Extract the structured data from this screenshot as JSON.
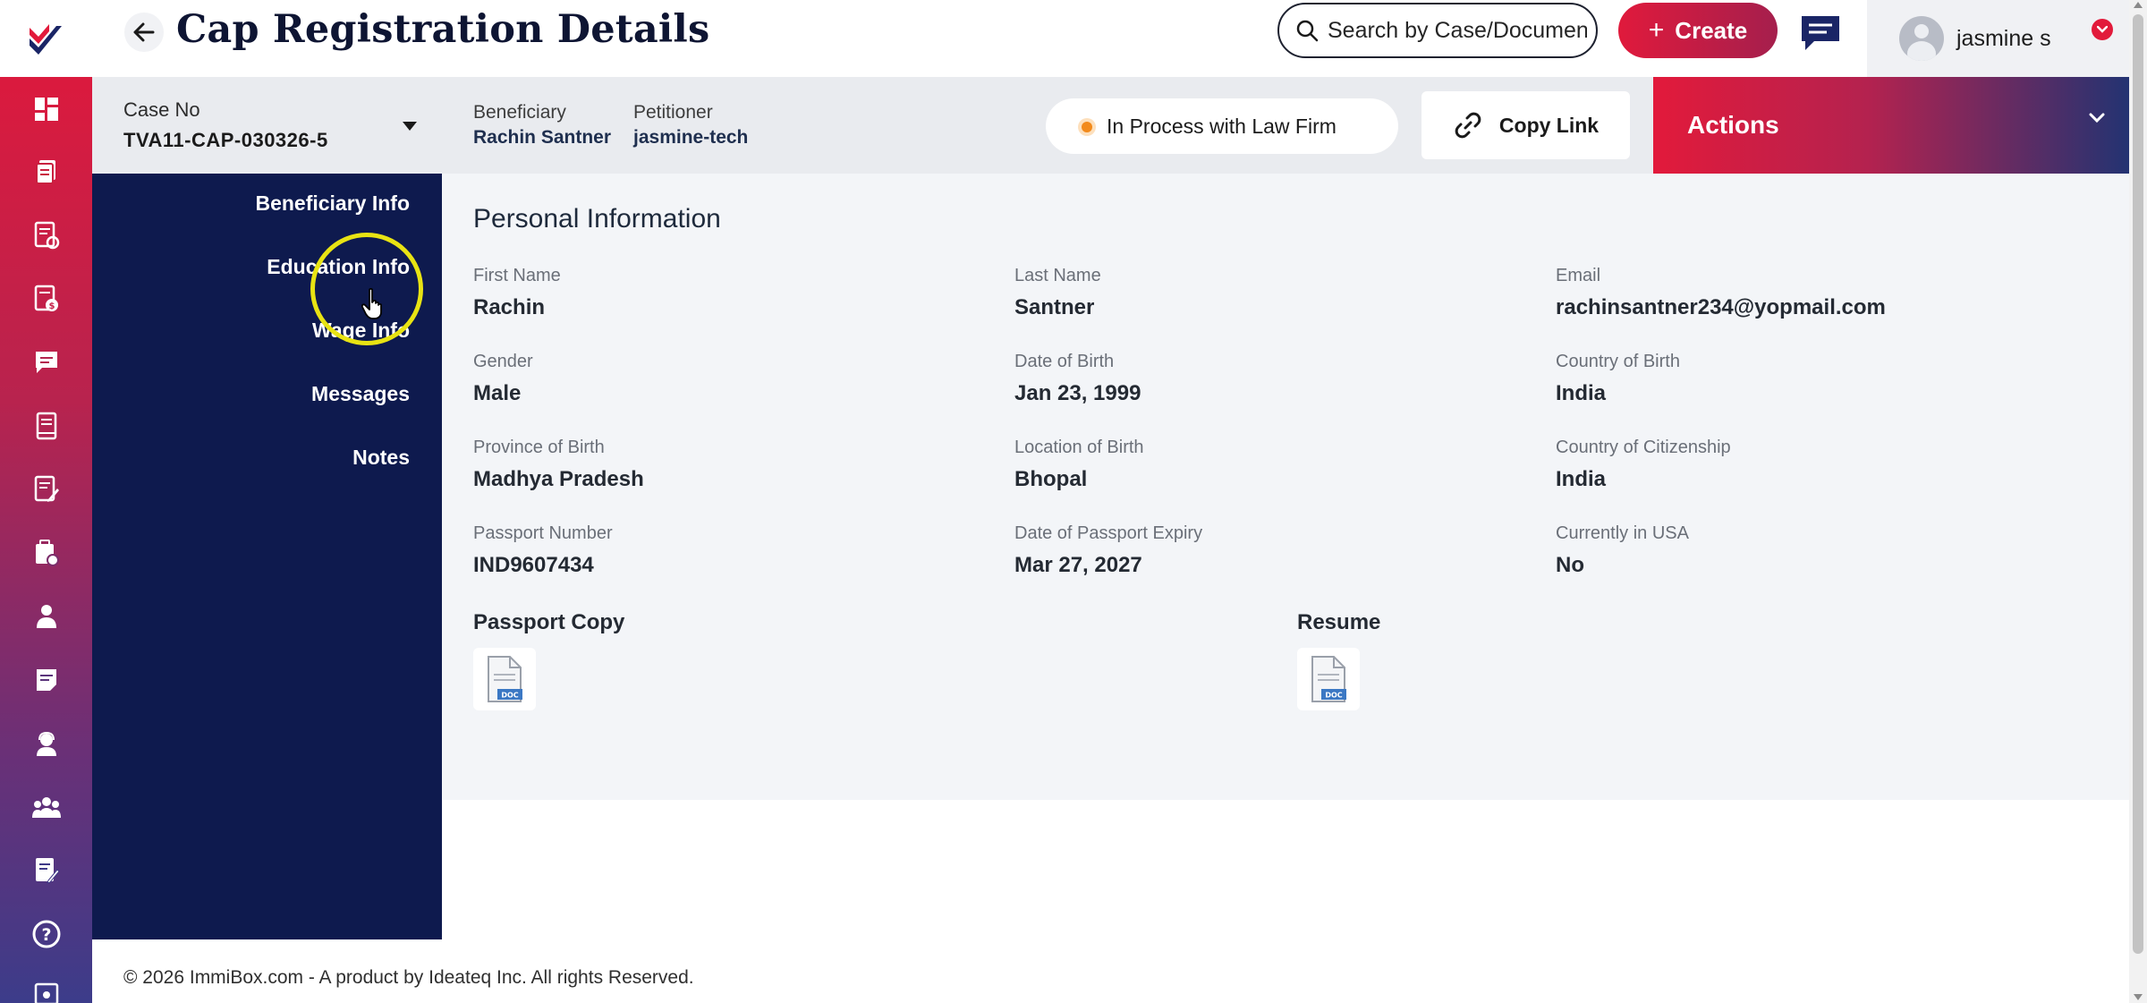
{
  "header": {
    "title": "Cap Registration Details",
    "search_placeholder": "Search by Case/Document",
    "create_label": "Create",
    "user_name": "jasmine s"
  },
  "case_bar": {
    "case_no_label": "Case No",
    "case_no_value": "TVA11-CAP-030326-5",
    "beneficiary_label": "Beneficiary",
    "beneficiary_value": "Rachin Santner",
    "petitioner_label": "Petitioner",
    "petitioner_value": "jasmine-tech",
    "status": "In Process with Law Firm",
    "copy_link_label": "Copy Link",
    "actions_label": "Actions"
  },
  "section_nav": {
    "items": [
      {
        "label": "Beneficiary Info"
      },
      {
        "label": "Education Info"
      },
      {
        "label": "Wage Info"
      },
      {
        "label": "Messages"
      },
      {
        "label": "Notes"
      }
    ]
  },
  "personal_info": {
    "title": "Personal Information",
    "fields": [
      {
        "label": "First Name",
        "value": "Rachin"
      },
      {
        "label": "Last Name",
        "value": "Santner"
      },
      {
        "label": "Email",
        "value": "rachinsantner234@yopmail.com"
      },
      {
        "label": "Gender",
        "value": "Male"
      },
      {
        "label": "Date of Birth",
        "value": "Jan 23, 1999"
      },
      {
        "label": "Country of Birth",
        "value": "India"
      },
      {
        "label": "Province of Birth",
        "value": "Madhya Pradesh"
      },
      {
        "label": "Location of Birth",
        "value": "Bhopal"
      },
      {
        "label": "Country of Citizenship",
        "value": "India"
      },
      {
        "label": "Passport Number",
        "value": "IND9607434"
      },
      {
        "label": "Date of Passport Expiry",
        "value": "Mar 27, 2027"
      },
      {
        "label": "Currently in USA",
        "value": "No"
      }
    ],
    "documents": [
      {
        "title": "Passport Copy",
        "icon": "doc-file-icon"
      },
      {
        "title": "Resume",
        "icon": "doc-file-icon"
      }
    ]
  },
  "footer": {
    "text": "© 2026 ImmiBox.com - A product by Ideateq Inc. All rights Reserved."
  },
  "colors": {
    "brand_red": "#e21a3b",
    "nav_navy": "#0e1a4e",
    "status_dot": "#f28a1c",
    "cursor_highlight": "#e8e313"
  },
  "rail_icons": [
    "dashboard-icon",
    "documents-icon",
    "forms-icon",
    "billing-icon",
    "messages-icon",
    "book-icon",
    "edit-list-icon",
    "case-check-icon",
    "person-icon",
    "notes-icon",
    "support-agent-icon",
    "team-icon",
    "edit-document-icon",
    "help-icon",
    "calendar-icon"
  ]
}
